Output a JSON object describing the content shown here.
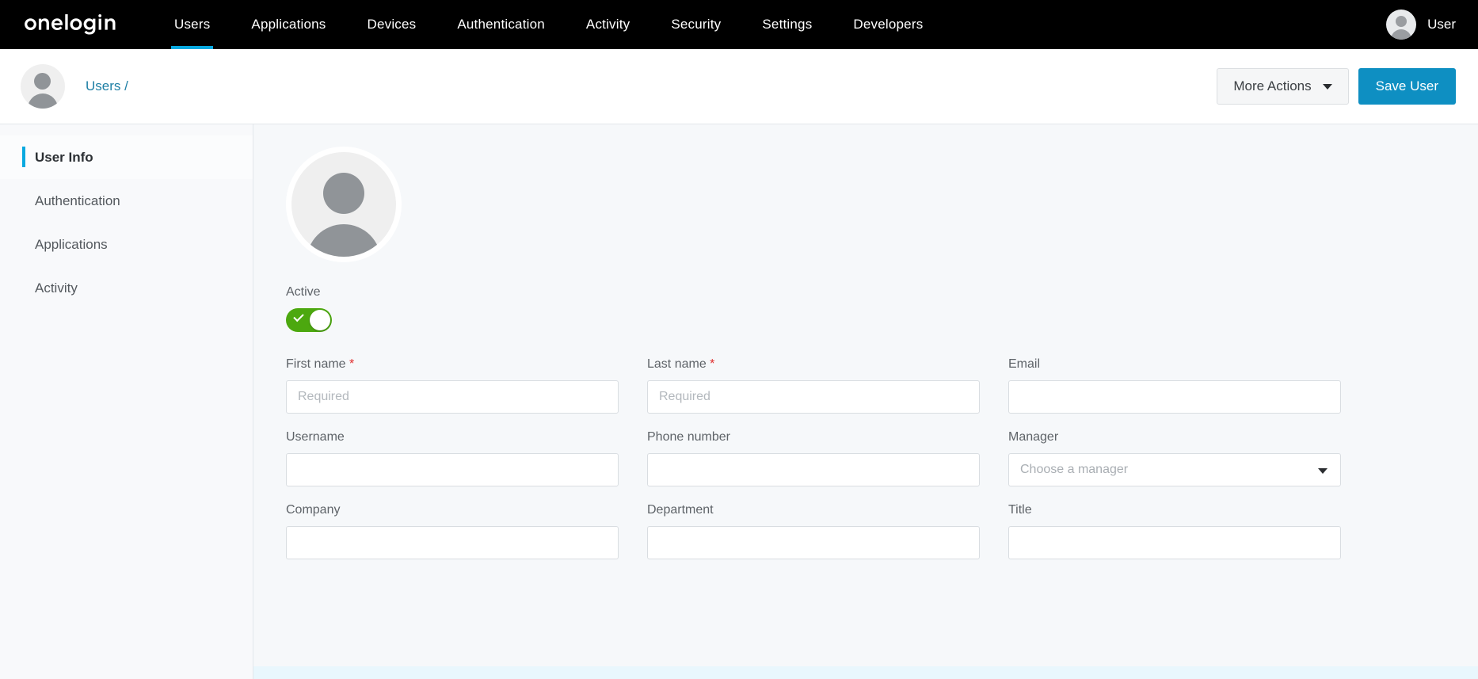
{
  "topnav": {
    "logo_text": "onelogin",
    "items": [
      {
        "label": "Users",
        "active": true
      },
      {
        "label": "Applications",
        "active": false
      },
      {
        "label": "Devices",
        "active": false
      },
      {
        "label": "Authentication",
        "active": false
      },
      {
        "label": "Activity",
        "active": false
      },
      {
        "label": "Security",
        "active": false
      },
      {
        "label": "Settings",
        "active": false
      },
      {
        "label": "Developers",
        "active": false
      }
    ],
    "user_label": "User",
    "active_underline_color": "#08a9e0",
    "background_color": "#000000"
  },
  "subheader": {
    "breadcrumb": "Users /",
    "more_actions_label": "More Actions",
    "save_label": "Save User",
    "save_color": "#0e8fc2",
    "breadcrumb_color": "#1e7fa5"
  },
  "sidebar": {
    "items": [
      {
        "label": "User Info"
      },
      {
        "label": "Authentication"
      },
      {
        "label": "Applications"
      },
      {
        "label": "Activity"
      }
    ]
  },
  "main": {
    "active_label": "Active",
    "active_state": "on",
    "toggle_color": "#4ca80f",
    "fields": [
      {
        "label": "First name",
        "required": true,
        "value": "",
        "placeholder": "Required",
        "type": "text"
      },
      {
        "label": "Last name",
        "required": true,
        "value": "",
        "placeholder": "Required",
        "type": "text"
      },
      {
        "label": "Email",
        "required": false,
        "value": "",
        "placeholder": "",
        "type": "text"
      },
      {
        "label": "Username",
        "required": false,
        "value": "",
        "placeholder": "",
        "type": "text"
      },
      {
        "label": "Phone number",
        "required": false,
        "value": "",
        "placeholder": "",
        "type": "text"
      },
      {
        "label": "Manager",
        "required": false,
        "value": "Choose a manager",
        "placeholder": "",
        "type": "select"
      },
      {
        "label": "Company",
        "required": false,
        "value": "",
        "placeholder": "",
        "type": "text"
      },
      {
        "label": "Department",
        "required": false,
        "value": "",
        "placeholder": "",
        "type": "text"
      },
      {
        "label": "Title",
        "required": false,
        "value": "",
        "placeholder": "",
        "type": "text"
      }
    ]
  }
}
